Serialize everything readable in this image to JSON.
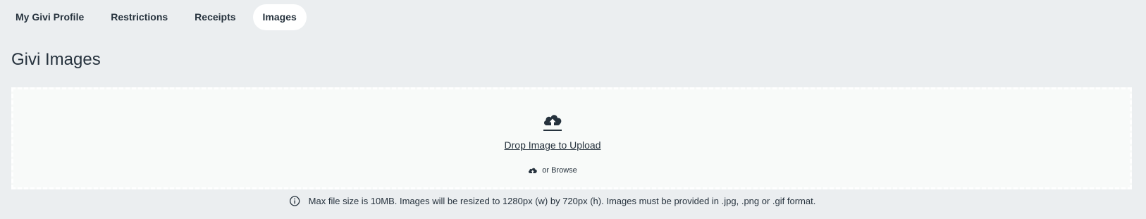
{
  "tabs": [
    {
      "label": "My Givi Profile",
      "active": false
    },
    {
      "label": "Restrictions",
      "active": false
    },
    {
      "label": "Receipts",
      "active": false
    },
    {
      "label": "Images",
      "active": true
    }
  ],
  "page": {
    "title": "Givi Images"
  },
  "dropzone": {
    "icon": "cloud-upload-icon",
    "drop_text": "Drop Image to Upload",
    "browse_icon": "cloud-upload-small-icon",
    "browse_text": "or Browse"
  },
  "info": {
    "icon": "info-icon",
    "text": "Max file size is 10MB. Images will be resized to 1280px (w) by 720px (h). Images must be provided in .jpg, .png or .gif format."
  },
  "colors": {
    "background": "#ebeef0",
    "active_tab": "#ffffff",
    "dropzone_bg": "#f8faf9",
    "text": "#26323d"
  }
}
